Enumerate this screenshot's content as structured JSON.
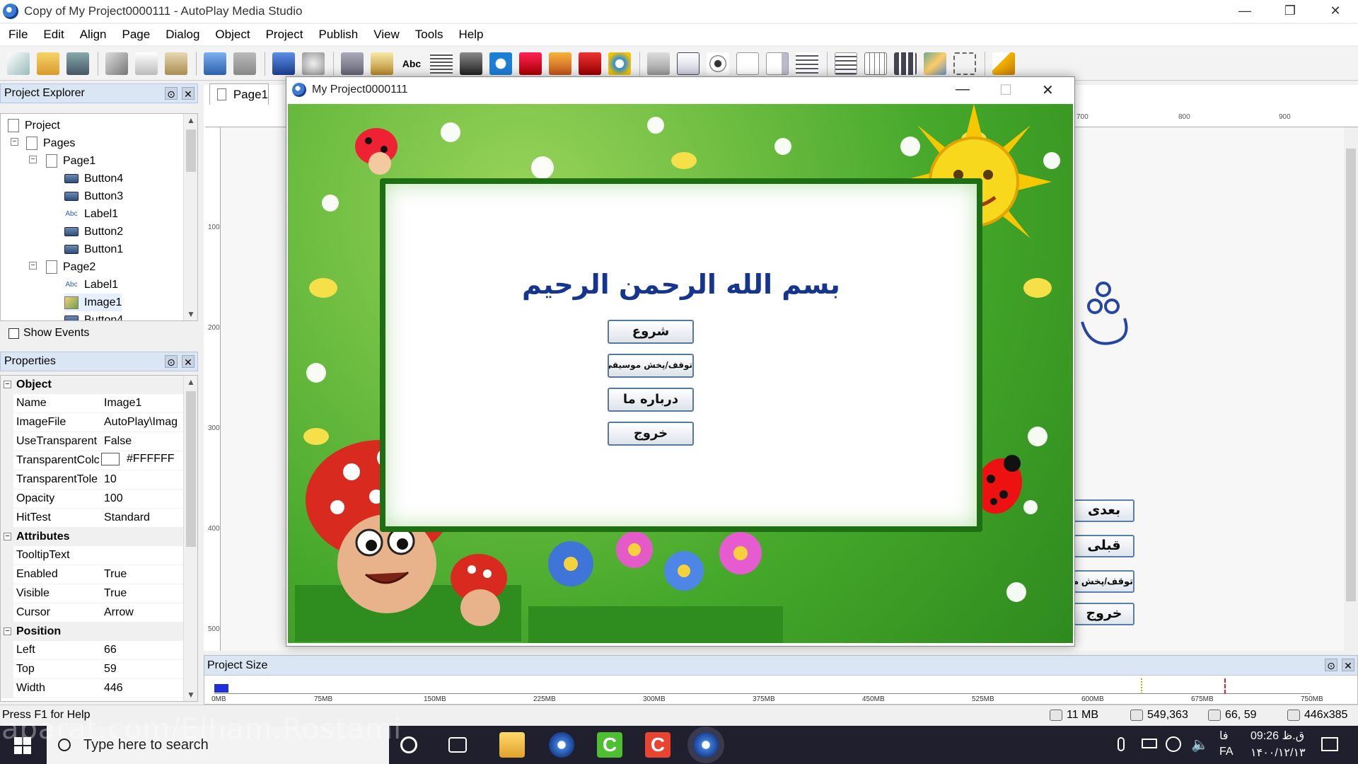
{
  "window": {
    "title": "Copy of My Project0000111 - AutoPlay Media Studio",
    "minimize": "—",
    "restore": "❐",
    "close": "✕"
  },
  "menu": [
    "File",
    "Edit",
    "Align",
    "Page",
    "Dialog",
    "Object",
    "Project",
    "Publish",
    "View",
    "Tools",
    "Help"
  ],
  "explorer": {
    "title": "Project Explorer",
    "items": [
      "Project",
      "Pages",
      "Page1",
      "Button4",
      "Button3",
      "Label1",
      "Button2",
      "Button1",
      "Page2",
      "Label1",
      "Image1",
      "Button4"
    ],
    "show_events": "Show Events"
  },
  "properties": {
    "title": "Properties",
    "categories": [
      "Object",
      "Attributes",
      "Position"
    ],
    "rows": [
      {
        "name": "Name",
        "value": "Image1"
      },
      {
        "name": "ImageFile",
        "value": "AutoPlay\\Imag"
      },
      {
        "name": "UseTransparent",
        "value": "False"
      },
      {
        "name": "TransparentColc",
        "value": "#FFFFFF"
      },
      {
        "name": "TransparentTole",
        "value": "10"
      },
      {
        "name": "Opacity",
        "value": "100"
      },
      {
        "name": "HitTest",
        "value": "Standard"
      },
      {
        "name": "TooltipText",
        "value": ""
      },
      {
        "name": "Enabled",
        "value": "True"
      },
      {
        "name": "Visible",
        "value": "True"
      },
      {
        "name": "Cursor",
        "value": "Arrow"
      },
      {
        "name": "Left",
        "value": "66"
      },
      {
        "name": "Top",
        "value": "59"
      },
      {
        "name": "Width",
        "value": "446"
      }
    ]
  },
  "document": {
    "tab": "Page1",
    "ruler_h": [
      "700",
      "800",
      "900"
    ],
    "ruler_v": [
      "100",
      "200",
      "300",
      "400",
      "500"
    ],
    "side_buttons": [
      "بعدی",
      "قبلی",
      "توقف/پخش مو",
      "خروج"
    ]
  },
  "preview": {
    "title": "My Project0000111",
    "heading": "بسم الله الرحمن الرحیم",
    "buttons": [
      "شروع",
      "توقف/پخش موسیقی",
      "درباره ما",
      "خروج"
    ]
  },
  "project_size": {
    "title": "Project Size",
    "labels": [
      "0MB",
      "75MB",
      "150MB",
      "225MB",
      "300MB",
      "375MB",
      "450MB",
      "525MB",
      "600MB",
      "675MB",
      "750MB"
    ],
    "used_fraction": 0.013
  },
  "status": {
    "help": "Press F1 for Help",
    "memory": "11 MB",
    "coords": "549,363",
    "position": "66, 59",
    "size": "446x385"
  },
  "taskbar": {
    "search_placeholder": "Type here to search",
    "time": "ق.ظ 09:26",
    "date": "۱۴۰۰/۱۲/۱۳",
    "lang": "FA",
    "lang_top": "فا"
  },
  "watermark": "aparat.com/Elham.Rostami",
  "colors": {
    "panel_header": "#dbe6f4",
    "heading": "#16358f",
    "frame_green": "#45a82a",
    "taskbar": "#1f1f2e"
  }
}
